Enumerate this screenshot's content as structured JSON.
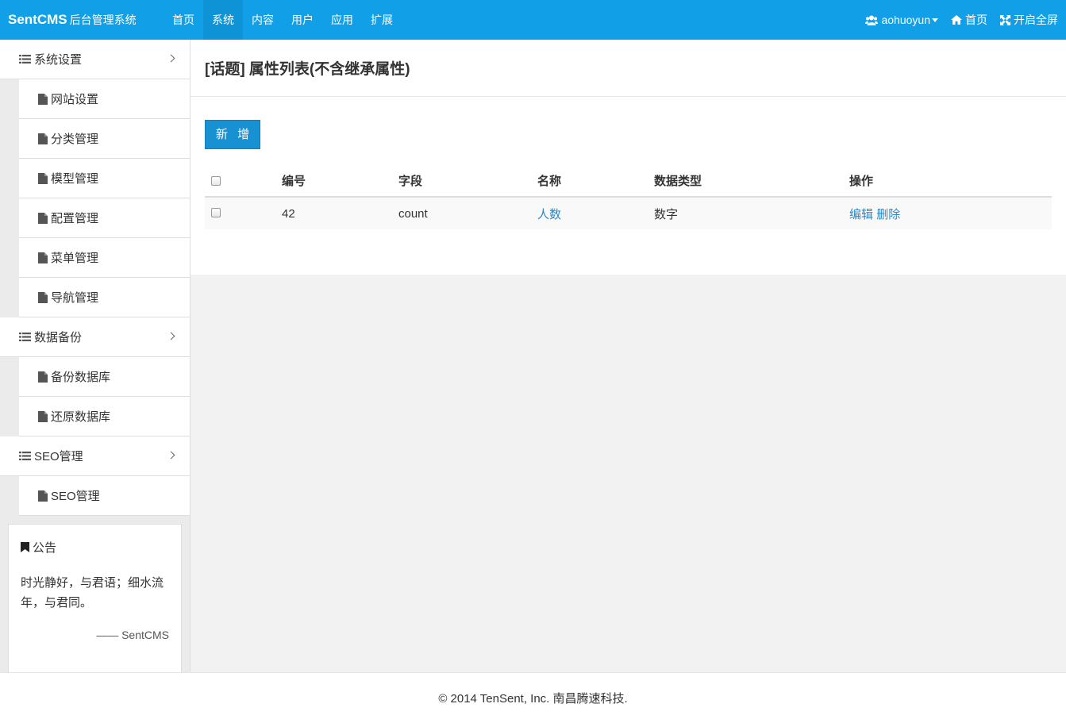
{
  "brand": {
    "name": "SentCMS",
    "subtitle": "后台管理系统"
  },
  "topnav": [
    {
      "label": "首页",
      "active": false
    },
    {
      "label": "系统",
      "active": true
    },
    {
      "label": "内容",
      "active": false
    },
    {
      "label": "用户",
      "active": false
    },
    {
      "label": "应用",
      "active": false
    },
    {
      "label": "扩展",
      "active": false
    }
  ],
  "user_menu": {
    "username": "aohuoyun",
    "home_label": "首页",
    "fullscreen_label": "开启全屏"
  },
  "sidebar": {
    "groups": [
      {
        "label": "系统设置",
        "items": [
          "网站设置",
          "分类管理",
          "模型管理",
          "配置管理",
          "菜单管理",
          "导航管理"
        ]
      },
      {
        "label": "数据备份",
        "items": [
          "备份数据库",
          "还原数据库"
        ]
      },
      {
        "label": "SEO管理",
        "items": [
          "SEO管理"
        ]
      }
    ]
  },
  "notice": {
    "title": "公告",
    "body": "时光静好，与君语；细水流年，与君同。",
    "signature": "—— SentCMS"
  },
  "page": {
    "title": "[话题] 属性列表(不含继承属性)",
    "add_button": "新 增"
  },
  "table": {
    "headers": [
      "编号",
      "字段",
      "名称",
      "数据类型",
      "操作"
    ],
    "rows": [
      {
        "id": "42",
        "field": "count",
        "name": "人数",
        "type": "数字",
        "edit": "编辑",
        "delete": "删除"
      }
    ]
  },
  "footer": {
    "text": "© 2014 TenSent, Inc. 南昌腾速科技."
  },
  "colors": {
    "primary": "#11a0e8",
    "link": "#2a87c8",
    "button": "#1891d2"
  }
}
